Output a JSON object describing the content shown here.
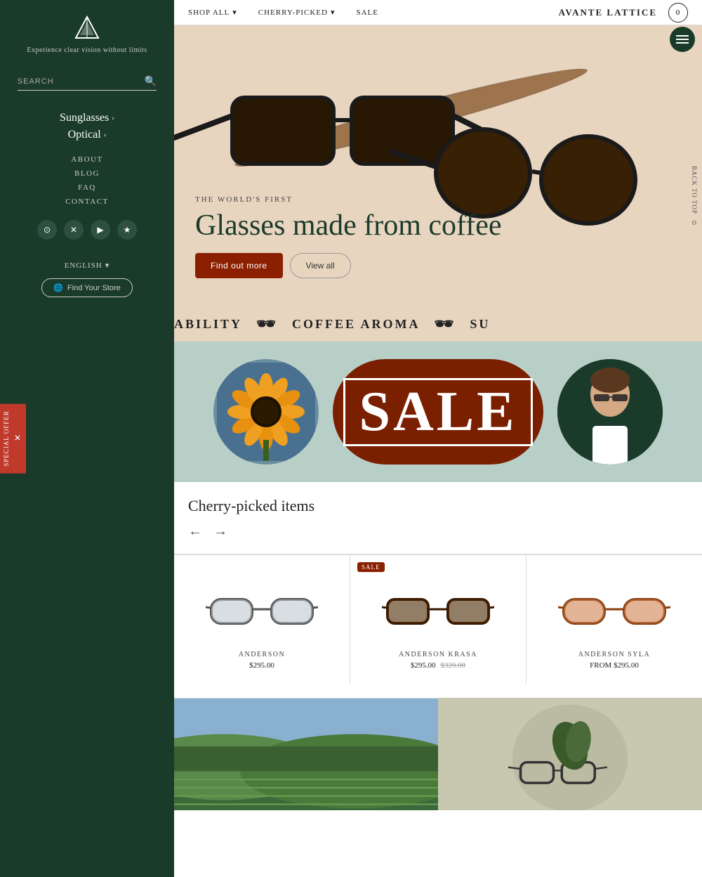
{
  "sidebar": {
    "logo_alt": "Brand Logo",
    "tagline": "Experience clear vision without limits",
    "search_placeholder": "SEARCH",
    "nav_main": [
      {
        "label": "Sunglasses",
        "chevron": "›"
      },
      {
        "label": "Optical",
        "chevron": "›"
      }
    ],
    "nav_sub": [
      {
        "label": "ABOUT"
      },
      {
        "label": "BLOG"
      },
      {
        "label": "FAQ"
      },
      {
        "label": "CONTACT"
      }
    ],
    "social_icons": [
      "instagram",
      "twitter",
      "youtube",
      "star"
    ],
    "lang": "ENGLISH",
    "store_btn": "Find Your Store",
    "special_offer": "SPECIAL OFFER"
  },
  "topnav": {
    "shop_all": "SHOP ALL",
    "cherry_picked": "CHERRY-PICKED",
    "sale": "SALE",
    "brand": "AVANTE LATTICE",
    "cart_count": "0"
  },
  "hero": {
    "subtitle": "THE WORLD'S FIRST",
    "title": "Glasses made from coffee",
    "btn_find_out": "Find out more",
    "btn_view_all": "View all"
  },
  "marquee": {
    "items": [
      "ABILITY",
      "COFFEE AROMA",
      "SU"
    ]
  },
  "sale_banner": {
    "text": "SALE"
  },
  "cherry_picked": {
    "title": "Cherry-picked items",
    "products": [
      {
        "name": "ANDERSON",
        "price": "$295.00",
        "sale": false
      },
      {
        "name": "ANDERSON KRASA",
        "price": "$295.00",
        "price_strike": "$320.00",
        "sale": true
      },
      {
        "name": "ANDERSON SYLA",
        "price": "FROM $295.00",
        "sale": false
      }
    ]
  }
}
